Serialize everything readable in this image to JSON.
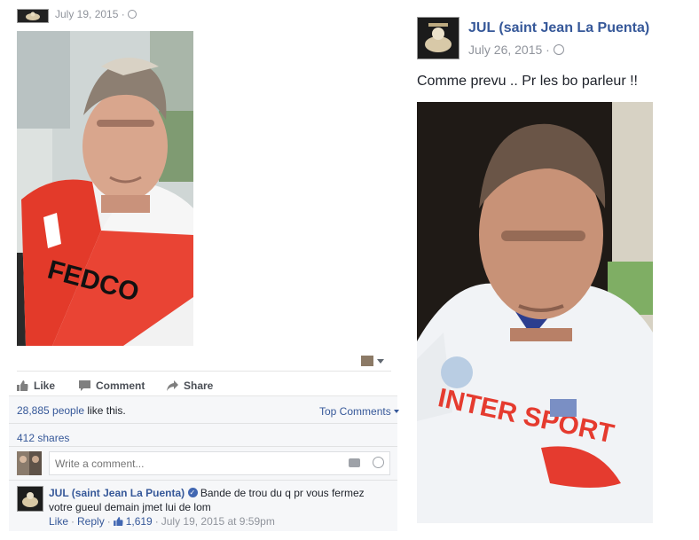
{
  "left_post": {
    "date": "July 19, 2015 · ",
    "globe_icon": "globe-icon",
    "actions": {
      "like": "Like",
      "comment": "Comment",
      "share": "Share"
    },
    "reactions": {
      "count_text": "28,885 people",
      "like_suffix": " like this.",
      "top_comments": "Top Comments",
      "shares": "412 shares"
    },
    "comment_box": {
      "placeholder": "Write a comment..."
    },
    "comment": {
      "author": "JUL (saint Jean La Puenta)",
      "text": "Bande de trou du q pr vous fermez votre gueul demain jmet lui de lom",
      "like": "Like",
      "reply": "Reply",
      "likes_count": "1,619",
      "timestamp": "July 19, 2015 at 9:59pm"
    },
    "photo_shirt_text": "FEDCO"
  },
  "right_post": {
    "author": "JUL (saint Jean La Puenta)",
    "date": "July 26, 2015 · ",
    "text": "Comme prevu .. Pr les bo parleur !!",
    "photo_shirt_text": "INTER SPORT"
  },
  "colors": {
    "link": "#365899",
    "muted": "#90949c",
    "verified": "#4267b2"
  }
}
